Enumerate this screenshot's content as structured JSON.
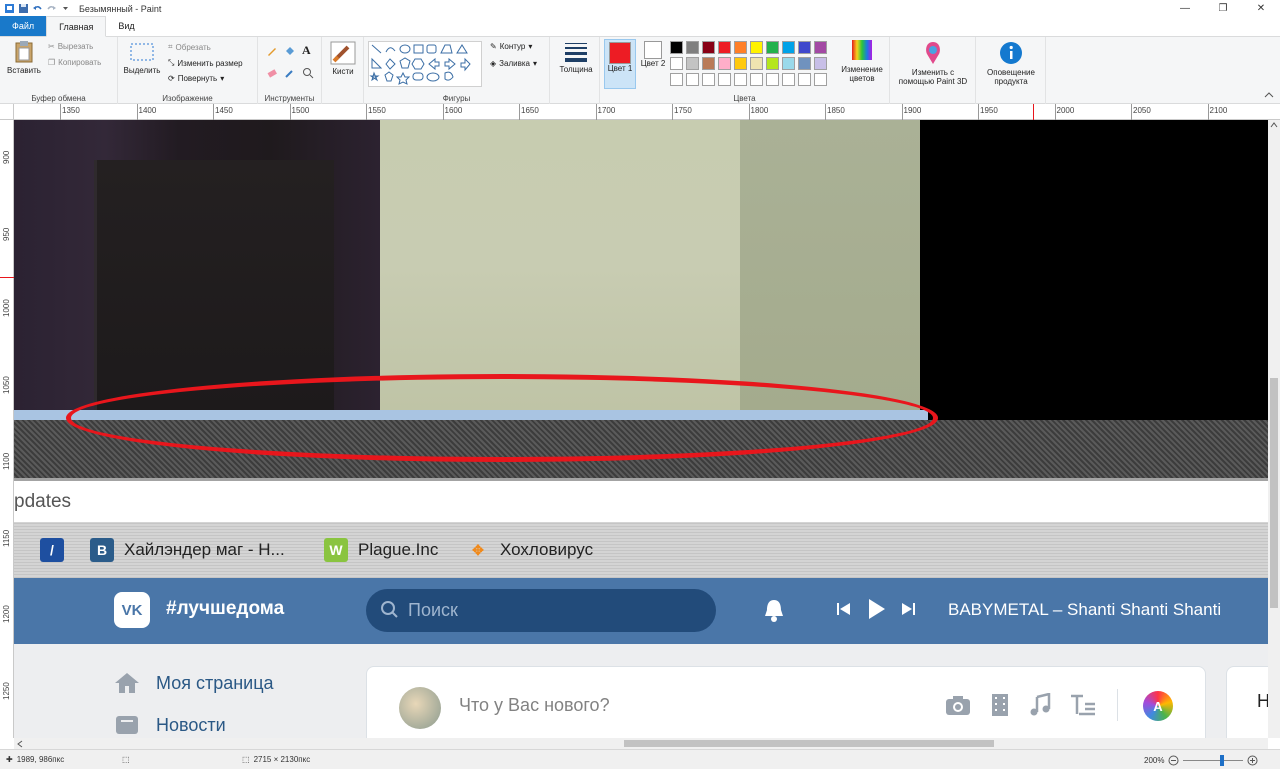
{
  "window": {
    "title": "Безымянный - Paint",
    "controls": [
      "—",
      "❐",
      "✕"
    ]
  },
  "tabs": [
    {
      "label": "Файл"
    },
    {
      "label": "Главная"
    },
    {
      "label": "Вид"
    }
  ],
  "ribbon": {
    "clipboard": {
      "group_label": "Буфер обмена",
      "paste": "Вставить",
      "cut": "Вырезать",
      "copy": "Копировать"
    },
    "image": {
      "group_label": "Изображение",
      "select": "Выделить",
      "crop": "Обрезать",
      "resize": "Изменить размер",
      "rotate": "Повернуть"
    },
    "tools": {
      "group_label": "Инструменты"
    },
    "brushes": {
      "label": "Кисти"
    },
    "shapes": {
      "group_label": "Фигуры",
      "outline": "Контур",
      "fill": "Заливка"
    },
    "size": {
      "label": "Толщина"
    },
    "colors": {
      "group_label": "Цвета",
      "color1": "Цвет 1",
      "color2": "Цвет 2",
      "color1_value": "#ed1c24",
      "color2_value": "#ffffff",
      "palette_row1": [
        "#000000",
        "#7f7f7f",
        "#880015",
        "#ed1c24",
        "#ff7f27",
        "#fff200",
        "#22b14c",
        "#00a2e8",
        "#3f48cc",
        "#a349a4"
      ],
      "palette_row2": [
        "#ffffff",
        "#c3c3c3",
        "#b97a57",
        "#ffaec9",
        "#ffc90e",
        "#efe4b0",
        "#b5e61d",
        "#99d9ea",
        "#7092be",
        "#c8bfe7"
      ],
      "edit": "Изменение цветов"
    },
    "paint3d": "Изменить с помощью Paint 3D",
    "product_alert": "Оповещение продукта"
  },
  "rulers": {
    "horizontal": [
      "1350",
      "1400",
      "1450",
      "1500",
      "1550",
      "1600",
      "1650",
      "1700",
      "1750",
      "1800",
      "1850",
      "1900",
      "1950",
      "2000",
      "2050",
      "2100"
    ],
    "vertical": [
      "900",
      "950",
      "1000",
      "1050",
      "1100",
      "1150",
      "1200",
      "1250"
    ]
  },
  "canvas": {
    "updates_text": "pdates",
    "bookmarks": [
      {
        "label": "",
        "color": "#1e4fa0",
        "glyph": "/"
      },
      {
        "label": "Хайлэндер маг - Н...",
        "color": "#2b5c8a",
        "glyph": "B"
      },
      {
        "label": "Plague.Inc",
        "color": "#8ac440",
        "glyph": "W"
      },
      {
        "label": "Хохловирус",
        "color": "#f08a1c",
        "glyph": "✥"
      }
    ],
    "vk": {
      "logo": "VK",
      "hashtag": "#лучшедома",
      "search_placeholder": "Поиск",
      "track": "BABYMETAL – Shanti Shanti Shanti",
      "nav": [
        "Моя страница",
        "Новости"
      ],
      "post_placeholder": "Что у Вас нового?",
      "avatar_letter": "A",
      "right_letter": "Н"
    },
    "annotation_color": "#e8161c"
  },
  "status": {
    "cursor": "1989, 986пкс",
    "image_size": "2715 × 2130пкс",
    "zoom": "200%",
    "zoom_fraction": 0.66
  }
}
